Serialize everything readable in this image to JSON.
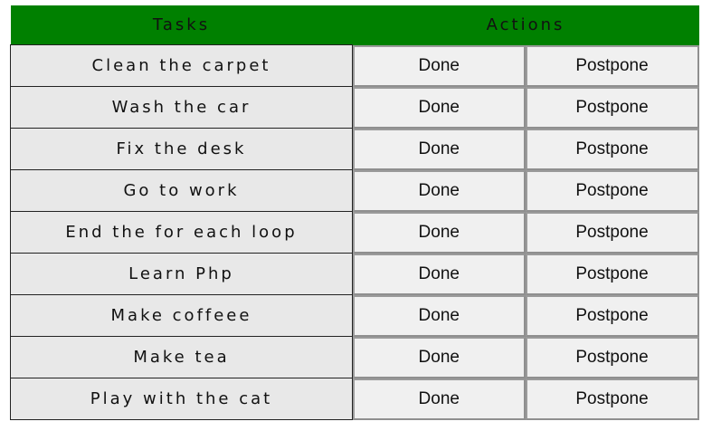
{
  "header": {
    "tasks_label": "Tasks",
    "actions_label": "Actions"
  },
  "rows": [
    {
      "task": "Clean the carpet",
      "done": "Done",
      "postpone": "Postpone"
    },
    {
      "task": "Wash the car",
      "done": "Done",
      "postpone": "Postpone"
    },
    {
      "task": "Fix the desk",
      "done": "Done",
      "postpone": "Postpone"
    },
    {
      "task": "Go to work",
      "done": "Done",
      "postpone": "Postpone"
    },
    {
      "task": "End the for each loop",
      "done": "Done",
      "postpone": "Postpone"
    },
    {
      "task": "Learn Php",
      "done": "Done",
      "postpone": "Postpone"
    },
    {
      "task": "Make coffeee",
      "done": "Done",
      "postpone": "Postpone"
    },
    {
      "task": "Make tea",
      "done": "Done",
      "postpone": "Postpone"
    },
    {
      "task": "Play with the cat",
      "done": "Done",
      "postpone": "Postpone"
    }
  ],
  "colors": {
    "header_bg": "#008000",
    "task_cell_bg": "#e8e8e8",
    "button_bg": "#f0f0f0"
  }
}
